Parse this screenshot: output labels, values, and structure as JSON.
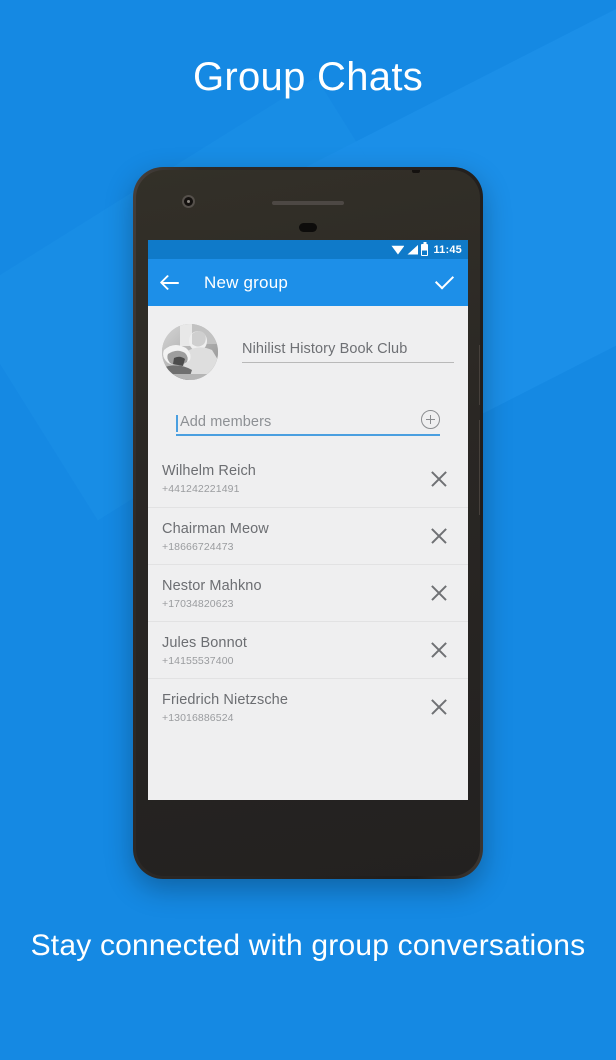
{
  "page": {
    "headline": "Group Chats",
    "subtitle": "Stay connected with group conversations",
    "background_color": "#1589e3"
  },
  "phone": {
    "status_bar": {
      "time": "11:45",
      "background_color": "#0f7ac9",
      "icons": [
        "wifi-icon",
        "signal-icon",
        "battery-icon"
      ]
    },
    "app_bar": {
      "background_color": "#1d8fe8",
      "back_label": "back-arrow",
      "title": "New group",
      "confirm_label": "check-icon"
    },
    "group": {
      "avatar_name": "group-avatar",
      "name_value": "Nihilist History Book Club",
      "add_members_placeholder": "Add members",
      "add_members_value": "",
      "add_button_label": "add-member-icon"
    },
    "members": [
      {
        "name": "Wilhelm Reich",
        "phone": "+441242221491"
      },
      {
        "name": "Chairman Meow",
        "phone": "+18666724473"
      },
      {
        "name": "Nestor Mahkno",
        "phone": "+17034820623"
      },
      {
        "name": "Jules Bonnot",
        "phone": "+14155537400"
      },
      {
        "name": "Friedrich Nietzsche",
        "phone": "+13016886524"
      }
    ],
    "nav_bar": {
      "back": "back-triangle-icon",
      "home": "home-circle-icon",
      "recents": "recents-square-icon"
    }
  }
}
